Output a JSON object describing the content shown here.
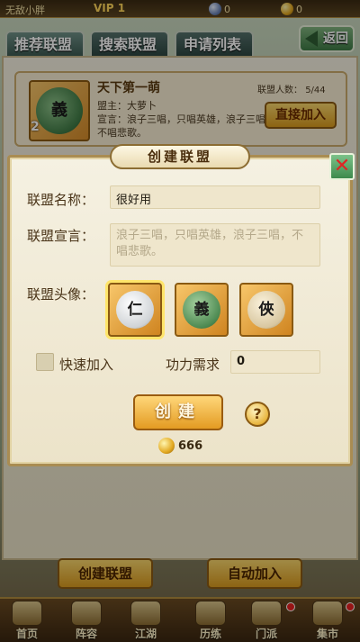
{
  "topbar": {
    "player_name": "无敌小胖",
    "vip_label": "VIP",
    "vip_level": "1",
    "gems": "0",
    "gold": "0"
  },
  "tabs": [
    {
      "label": "推荐联盟",
      "active": true
    },
    {
      "label": "搜索联盟",
      "active": false
    },
    {
      "label": "申请列表",
      "active": false
    }
  ],
  "back_label": "返回",
  "guild_card": {
    "level": "2",
    "name": "天下第一萌",
    "leader_label": "盟主：",
    "leader": "大萝卜",
    "declaration_label": "宣言：",
    "declaration": "浪子三唱，只唱英雄，浪子三唱，不唱悲歌。",
    "members_label": "联盟人数：",
    "members": "5/44",
    "join_label": "直接加入",
    "emblem_char": "義"
  },
  "modal": {
    "title": "创建联盟",
    "close_glyph": "✕",
    "name_label": "联盟名称：",
    "name_value": "很好用",
    "declaration_label": "联盟宣言：",
    "declaration_placeholder": "浪子三唱，只唱英雄，浪子三唱，不唱悲歌。",
    "avatar_label": "联盟头像：",
    "avatars": [
      {
        "char": "仁",
        "selected": true
      },
      {
        "char": "義",
        "selected": false
      },
      {
        "char": "俠",
        "selected": false
      }
    ],
    "quick_join_label": "快速加入",
    "power_label": "功力需求",
    "power_value": "0",
    "create_label": "创建",
    "help_glyph": "?",
    "cost": "666"
  },
  "bottom_buttons": {
    "create": "创建联盟",
    "auto_join": "自动加入"
  },
  "bottom_nav": [
    {
      "label": "首页"
    },
    {
      "label": "阵容"
    },
    {
      "label": "江湖"
    },
    {
      "label": "历练"
    },
    {
      "label": "门派"
    },
    {
      "label": "集市"
    }
  ]
}
